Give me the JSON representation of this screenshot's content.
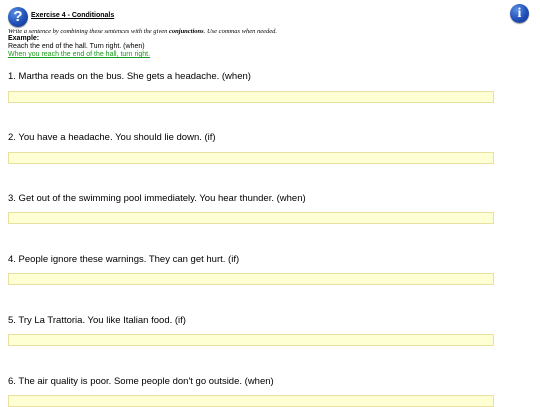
{
  "header": {
    "title": "Exercise 4 - Conditionals",
    "help_glyph": "?",
    "info_glyph": "i"
  },
  "instructions": {
    "prefix": "Write a sentence by combining these sentences with the given ",
    "bold": "conjunctions",
    "suffix": ". Use commas when needed."
  },
  "example": {
    "label": "Example",
    "label_suffix": ":",
    "sentence": "Reach the end of the hall. Turn right. (when)",
    "answer": "When you reach the end of the hall, turn right."
  },
  "questions": [
    {
      "text": "1. Martha reads on the bus. She gets a headache. (when)",
      "value": ""
    },
    {
      "text": "2. You have a headache. You should lie down. (if)",
      "value": ""
    },
    {
      "text": "3. Get out of the swimming pool immediately. You hear thunder. (when)",
      "value": ""
    },
    {
      "text": "4. People ignore these warnings. They can get hurt. (if)",
      "value": ""
    },
    {
      "text": "5. Try La Trattoria. You like Italian food. (if)",
      "value": ""
    },
    {
      "text": "6. The air quality is poor. Some people don't go outside. (when)",
      "value": ""
    }
  ],
  "colors": {
    "input_background": "#ffffd4",
    "example_answer": "#1a9a1a",
    "icon_blue": "#1f4fb8"
  }
}
